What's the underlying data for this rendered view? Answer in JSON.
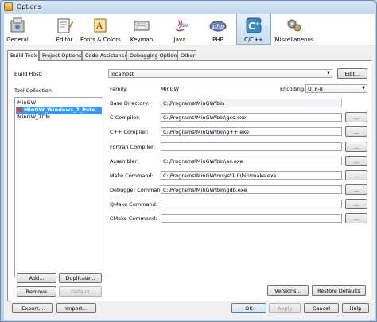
{
  "window": {
    "title": "Options"
  },
  "toolbar": {
    "items": [
      {
        "label": "General",
        "icon": "general-icon"
      },
      {
        "label": "Editor",
        "icon": "editor-icon"
      },
      {
        "label": "Fonts & Colors",
        "icon": "fonts-colors-icon"
      },
      {
        "label": "Keymap",
        "icon": "keymap-icon"
      },
      {
        "label": "Java",
        "icon": "java-icon",
        "icon_text": "Java"
      },
      {
        "label": "PHP",
        "icon": "php-icon",
        "icon_text": "php"
      },
      {
        "label": "C/C++",
        "icon": "c-cpp-icon",
        "active": true
      },
      {
        "label": "Miscellaneous",
        "icon": "miscellaneous-icon"
      }
    ]
  },
  "tabs": [
    {
      "label": "Build Tools",
      "active": true
    },
    {
      "label": "Project Options"
    },
    {
      "label": "Code Assistance"
    },
    {
      "label": "Debugging Options"
    },
    {
      "label": "Other"
    }
  ],
  "build_tools": {
    "build_host_label": "Build Host:",
    "build_host_value": "localhost",
    "edit_button": "Edit...",
    "tool_collection_label": "Tool Collection:",
    "collections": [
      "MinGW",
      "MinGW_Windows_7_Pete",
      "MinGW_TDM"
    ],
    "selected_collection": "MinGW_Windows_7_Pete",
    "family_label": "Family:",
    "family_value": "MinGW",
    "encoding_label": "Encoding:",
    "encoding_value": "UTF-8",
    "base_directory_label": "Base Directory:",
    "base_directory_value": "C:\\Programs\\MinGW\\bin",
    "tools": [
      {
        "label": "C Compiler:",
        "value": "C:\\Programs\\MinGW\\bin\\gcc.exe"
      },
      {
        "label": "C++ Compiler:",
        "value": "C:\\Programs\\MinGW\\bin\\g++.exe"
      },
      {
        "label": "Fortran Compiler:",
        "value": ""
      },
      {
        "label": "Assembler:",
        "value": "C:\\Programs\\MinGW\\bin\\as.exe"
      },
      {
        "label": "Make Command:",
        "value": "C:\\Programs\\MinGW\\msys\\1.0\\bin\\make.exe"
      },
      {
        "label": "Debugger Command:",
        "value": "C:\\Programs\\MinGW\\bin\\gdb.exe"
      },
      {
        "label": "QMake Command:",
        "value": ""
      },
      {
        "label": "CMake Command:",
        "value": ""
      }
    ],
    "browse_label": "...",
    "add_button": "Add...",
    "duplicate_button": "Duplicate...",
    "remove_button": "Remove",
    "default_button": "Default",
    "versions_button": "Versions...",
    "restore_defaults_button": "Restore Defaults"
  },
  "footer": {
    "export_button": "Export...",
    "import_button": "Import...",
    "ok_button": "OK",
    "apply_button": "Apply",
    "cancel_button": "Cancel",
    "help_button": "Help"
  },
  "colors": {
    "selection": "#3399ff",
    "active_tab_bg": "#c7dcf3"
  }
}
